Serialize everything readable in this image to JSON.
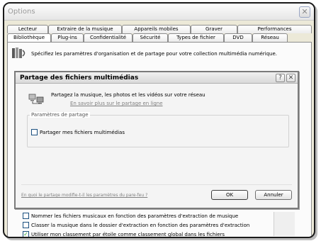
{
  "window": {
    "title": "Options",
    "close_glyph": "✕"
  },
  "tabs_back": [
    "Lecteur",
    "Extraire de la musique",
    "Appareils mobiles",
    "Graver",
    "Performances"
  ],
  "tabs_front": [
    "Bibliothèque",
    "Plug-ins",
    "Confidentialité",
    "Sécurité",
    "Types de fichier",
    "DVD",
    "Réseau"
  ],
  "active_tab": "Bibliothèque",
  "library": {
    "icon": "media-library-icon",
    "description": "Spécifiez les paramètres d'organisation et de partage pour votre collection multimédia numérique."
  },
  "options": [
    {
      "label": "Nommer les fichiers musicaux en fonction des paramètres d'extraction de musique",
      "checked": false
    },
    {
      "label": "Classer la musique dans le dossier d'extraction en fonction des paramètres d'extraction",
      "checked": false
    },
    {
      "label": "Utiliser mon classement par étoile comme classement global dans les fichiers",
      "checked": true
    }
  ],
  "dialog": {
    "title": "Partage des fichiers multimédias",
    "help_glyph": "?",
    "close_glyph": "✕",
    "share_icon": "network-share-icon",
    "share_text": "Partagez la musique, les photos et les vidéos sur votre réseau",
    "learn_more": "En savoir plus sur le partage en ligne",
    "group_label": "Paramètres de partage",
    "share_checkbox": {
      "label": "Partager mes fichiers multimédias",
      "checked": false
    },
    "firewall_link": "En quoi le partage modifie-t-il les paramètres du pare-feu ?",
    "ok_label": "OK",
    "cancel_label": "Annuler"
  }
}
